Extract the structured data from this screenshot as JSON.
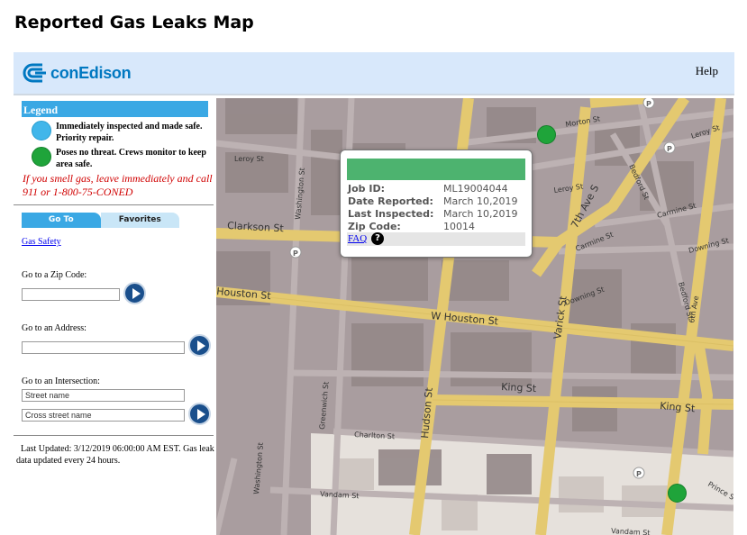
{
  "page": {
    "title": "Reported Gas Leaks Map"
  },
  "header": {
    "logo_text": "conEdison",
    "help_label": "Help"
  },
  "legend": {
    "title": "Legend",
    "items": [
      {
        "color": "#41b6ea",
        "label": "Immediately inspected and made safe. Priority repair."
      },
      {
        "color": "#1fa43a",
        "label": "Poses no threat. Crews monitor to keep area safe."
      }
    ],
    "warning": "If you smell gas, leave immediately and call 911 or 1-800-75-CONED"
  },
  "tabs": [
    {
      "label": "Go To",
      "active": true
    },
    {
      "label": "Favorites",
      "active": false
    }
  ],
  "links": {
    "gas_safety": "Gas Safety"
  },
  "goto": {
    "zip_label": "Go to a Zip Code:",
    "zip_value": "",
    "address_label": "Go to an Address:",
    "address_value": "",
    "intersection_label": "Go to an Intersection:",
    "street_placeholder": "Street name",
    "cross_street_placeholder": "Cross street name"
  },
  "status": {
    "last_updated": "Last Updated: 3/12/2019 06:00:00 AM EST. Gas leak data updated every 24 hours."
  },
  "popup": {
    "fields": [
      {
        "key": "Job ID:",
        "value": "ML19004044"
      },
      {
        "key": "Date Reported:",
        "value": "March 10,2019"
      },
      {
        "key": "Last Inspected:",
        "value": "March 10,2019"
      },
      {
        "key": "Zip Code:",
        "value": "10014"
      }
    ],
    "faq_label": "FAQ",
    "faq_icon": "question-icon",
    "bar_color": "#4db36f"
  },
  "map": {
    "streets": {
      "morton": "Morton St",
      "leroy_top": "Leroy St",
      "leroy_left": "Leroy St",
      "leroy_mid": "Leroy St",
      "bedford_top": "Bedford St",
      "seventh_ave": "7th Ave S",
      "carmine_right": "Carmine St",
      "carmine_mid": "Carmine St",
      "downing_right": "Downing St",
      "downing_mid": "Downing St",
      "clarkson": "Clarkson St",
      "washington_top": "Washington St",
      "houston_left": "Houston St",
      "w_houston": "W Houston St",
      "varick": "Varick St",
      "bedford_right": "Bedford St",
      "sixth_ave": "6th Ave",
      "king_mid": "King St",
      "king_right": "King St",
      "greenwich": "Greenwich St",
      "hudson": "Hudson St",
      "charlton": "Charlton St",
      "washington_bottom": "Washington St",
      "vandam_left": "Vandam St",
      "vandam_right": "Vandam St",
      "prince": "Prince St"
    },
    "parking_label": "P",
    "markers": [
      {
        "type": "no-threat",
        "color": "#1fa43a"
      },
      {
        "type": "no-threat",
        "color": "#1fa43a"
      }
    ]
  }
}
